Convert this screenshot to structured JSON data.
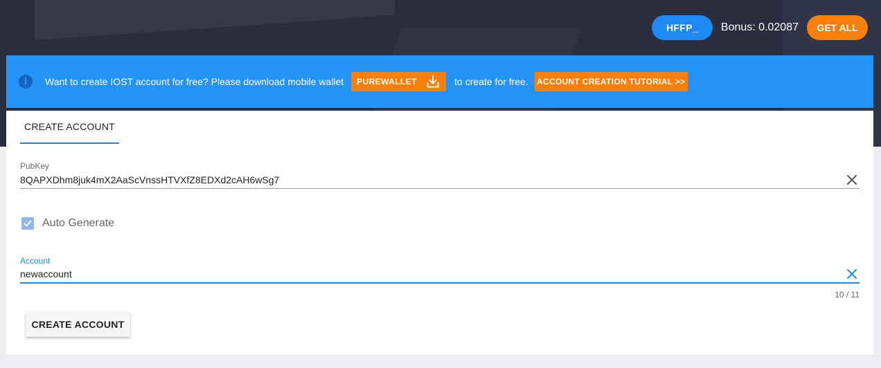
{
  "header": {
    "user_label": "HFFP_",
    "bonus_text": "Bonus: 0.02087",
    "get_all_label": "GET ALL"
  },
  "banner": {
    "text_before": "Want to create IOST account for free? Please download mobile wallet",
    "purewallet_label": "PUREWALLET",
    "text_after": "to create for free.",
    "tutorial_label": "ACCOUNT CREATION TUTORIAL >>"
  },
  "tabs": [
    {
      "label": "CREATE ACCOUNT",
      "active": true
    }
  ],
  "form": {
    "pubkey": {
      "label": "PubKey",
      "value": "8QAPXDhm8juk4mX2AaScVnssHTVXfZ8EDXd2cAH6wSg7"
    },
    "auto_generate": {
      "label": "Auto Generate",
      "checked": true
    },
    "account": {
      "label": "Account",
      "value": "newaccount",
      "counter": "10 / 11"
    },
    "submit_label": "CREATE ACCOUNT"
  },
  "icons": {
    "info": "info-circle-icon",
    "download": "download-icon",
    "clear": "close-icon",
    "check": "check-icon"
  },
  "colors": {
    "header_bg": "#2a2d3e",
    "banner_bg": "#2394f5",
    "accent_orange": "#f77f0c",
    "primary_blue": "#1e88e5",
    "checkbox_bg": "#8db6ee"
  }
}
